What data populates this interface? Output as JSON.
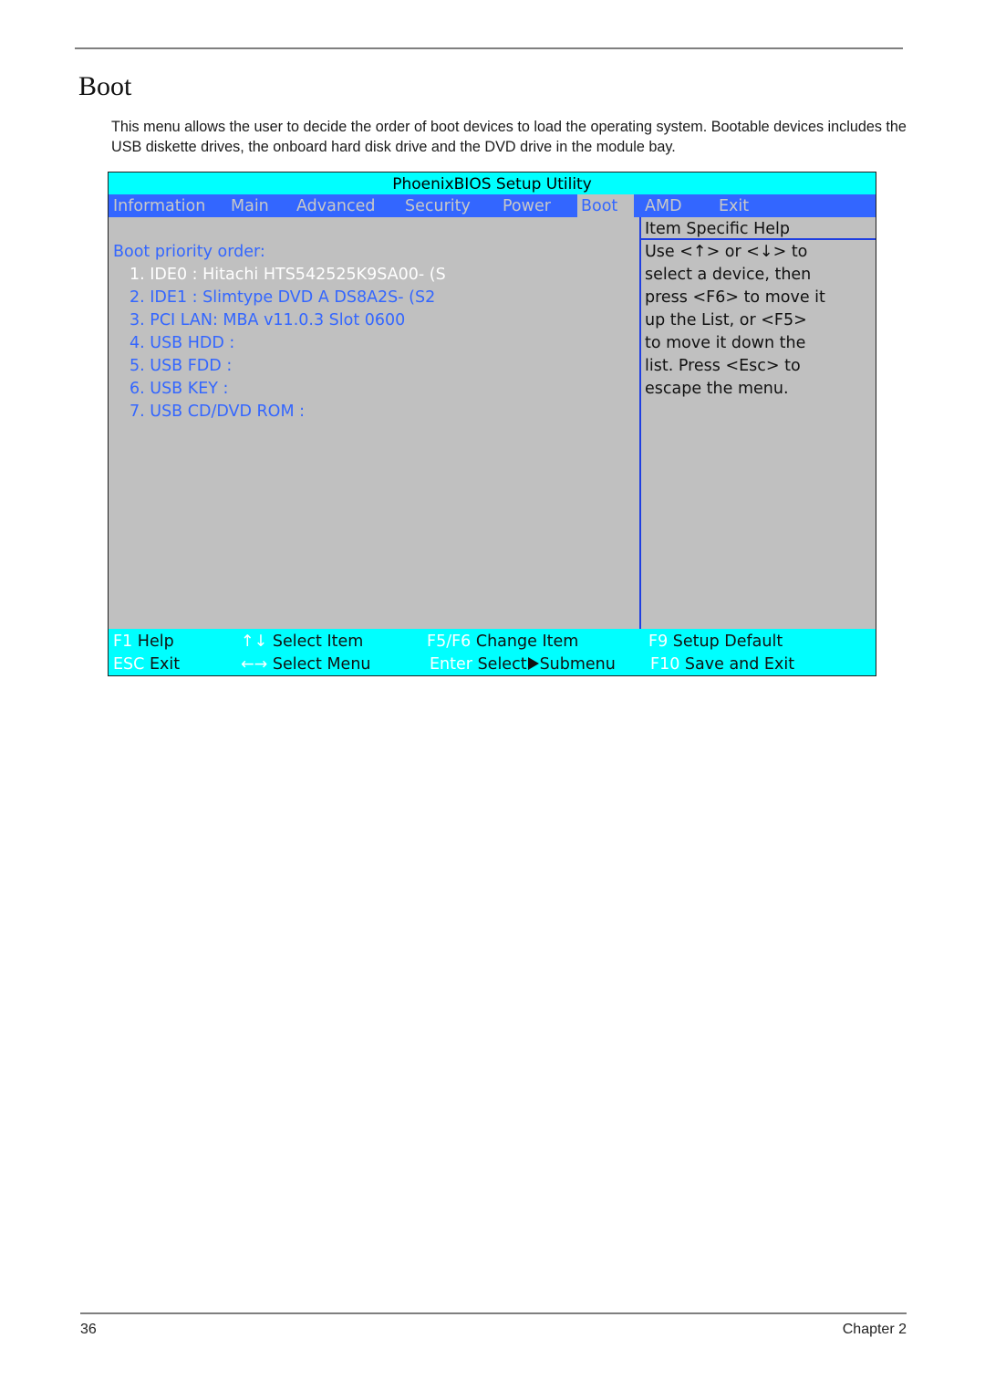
{
  "document": {
    "title": "Boot",
    "intro": "This menu allows the user to decide the order of boot devices to load the operating system. Bootable devices includes the USB diskette drives, the onboard hard disk drive and the DVD drive in the module bay.",
    "footer": {
      "page_number": "36",
      "chapter": "Chapter 2"
    }
  },
  "bios": {
    "title": "PhoenixBIOS Setup Utility",
    "tabs": [
      {
        "label": "Information",
        "active": false
      },
      {
        "label": "Main",
        "active": false
      },
      {
        "label": "Advanced",
        "active": false
      },
      {
        "label": "Security",
        "active": false
      },
      {
        "label": "Power",
        "active": false
      },
      {
        "label": "Boot",
        "active": true
      },
      {
        "label": "AMD",
        "active": false
      },
      {
        "label": "Exit",
        "active": false
      }
    ],
    "boot_heading": "Boot priority order:",
    "boot_items": [
      {
        "label": "1. IDE0 : Hitachi HTS542525K9SA00- (S",
        "selected": true
      },
      {
        "label": "2. IDE1 : Slimtype DVD A DS8A2S- (S2",
        "selected": false
      },
      {
        "label": "3. PCI LAN: MBA v11.0.3 Slot 0600",
        "selected": false
      },
      {
        "label": "4. USB HDD :",
        "selected": false
      },
      {
        "label": "5. USB FDD :",
        "selected": false
      },
      {
        "label": "6. USB KEY :",
        "selected": false
      },
      {
        "label": "7. USB CD/DVD ROM :",
        "selected": false
      }
    ],
    "help": {
      "header": "Item Specific Help",
      "lines": [
        "Use <↑> or <↓> to",
        "select a device, then",
        "press <F6> to move it",
        "up the List, or <F5>",
        "to move it down the",
        "list. Press <Esc> to",
        "escape the menu."
      ]
    },
    "keybar": {
      "f1_key": "F1",
      "f1_label": "Help",
      "updown_icon": "↑↓",
      "updown_label": "Select Item",
      "f5f6_key": "F5/F6",
      "f5f6_label": "Change Item",
      "f9_key": "F9",
      "f9_label": "Setup Default",
      "esc_key": "ESC",
      "esc_label": "Exit",
      "leftright_icon": "←→",
      "leftright_label": "Select Menu",
      "enter_key": "Enter",
      "enter_label_a": "Select",
      "enter_label_b": "Submenu",
      "f10_key": "F10",
      "f10_label": "Save and Exit"
    },
    "colors": {
      "titlebar_bg": "#00ffff",
      "tabbar_bg": "#3366ff",
      "body_bg": "#c0c0c0",
      "item_text": "#3366ff",
      "selected_text": "#ffffff"
    }
  }
}
